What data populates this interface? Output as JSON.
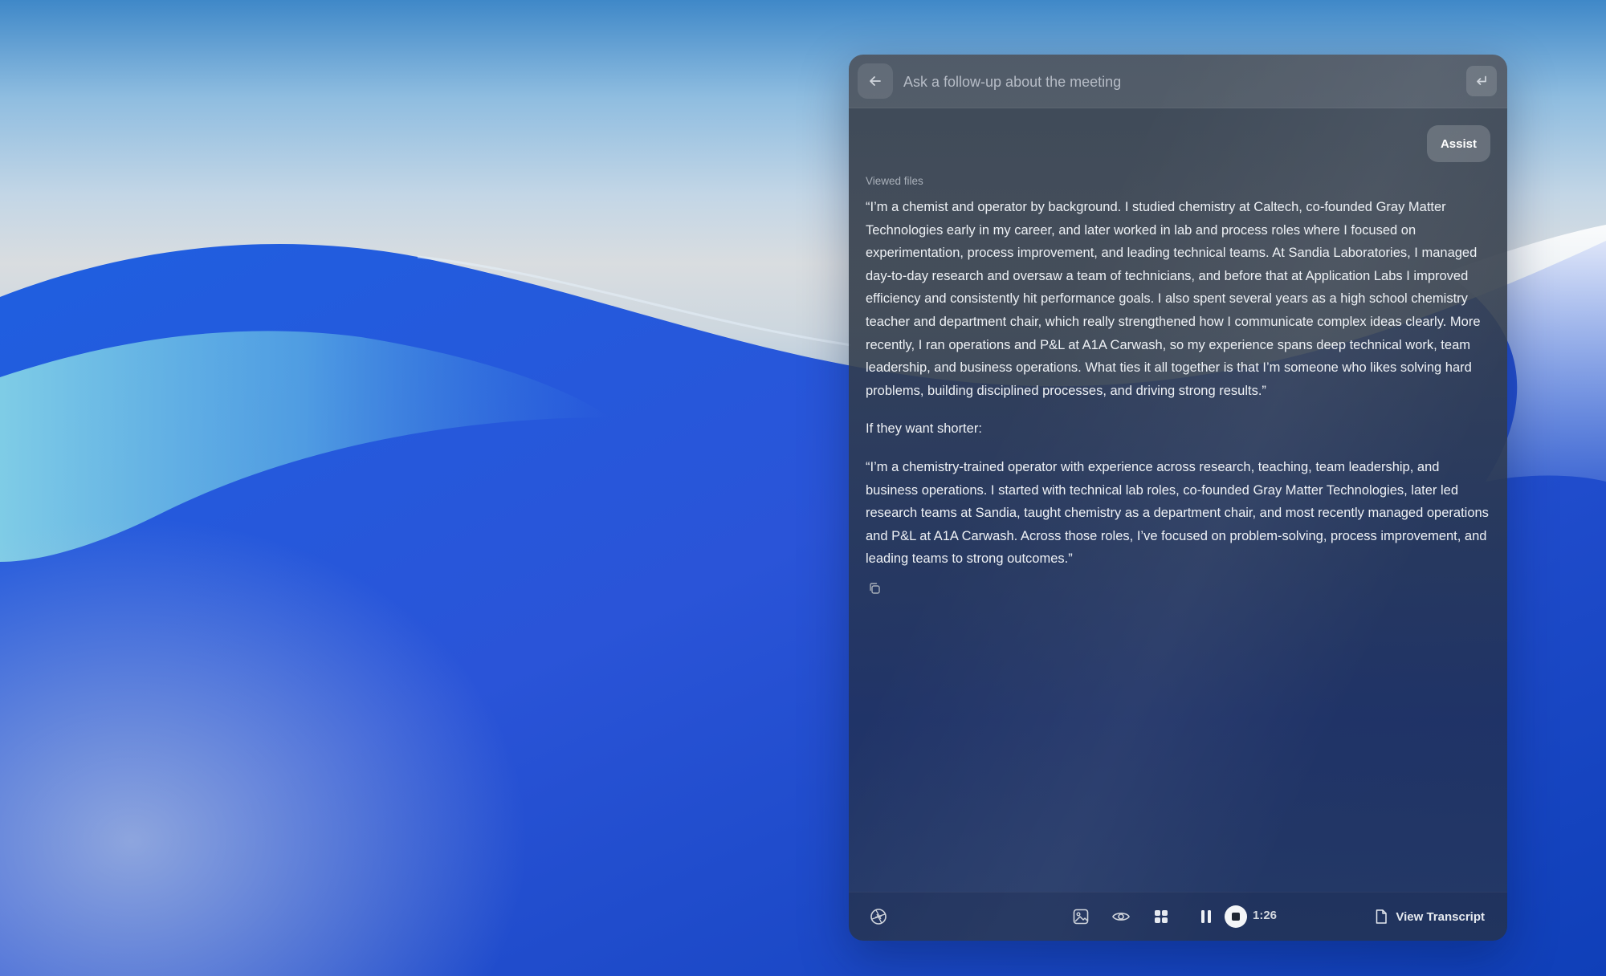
{
  "colors": {
    "panel_text": "#eef1f5",
    "muted_text": "#a9b0ba",
    "icon": "#d0d5dc"
  },
  "query_bar": {
    "placeholder": "Ask a follow-up about the meeting",
    "back_icon": "arrow-left-icon",
    "submit_icon": "enter-return-icon"
  },
  "assist_chip": {
    "label": "Assist"
  },
  "response": {
    "viewed_files_label": "Viewed files",
    "paragraphs": [
      "“I’m a chemist and operator by background. I studied chemistry at Caltech, co-founded Gray Matter Technologies early in my career, and later worked in lab and process roles where I focused on experimentation, process improvement, and leading technical teams. At Sandia Laboratories, I managed day-to-day research and oversaw a team of technicians, and before that at Application Labs I improved efficiency and consistently hit performance goals. I also spent several years as a high school chemistry teacher and department chair, which really strengthened how I communicate complex ideas clearly. More recently, I ran operations and P&L at A1A Carwash, so my experience spans deep technical work, team leadership, and business operations. What ties it all together is that I’m someone who likes solving hard problems, building disciplined processes, and driving strong results.”",
      "If they want shorter:",
      "“I’m a chemistry-trained operator with experience across research, teaching, team leadership, and business operations. I started with technical lab roles, co-founded Gray Matter Technologies, later led research teams at Sandia, taught chemistry as a department chair, and most recently managed operations and P&L at A1A Carwash. Across those roles, I’ve focused on problem-solving, process improvement, and leading teams to strong outcomes.”"
    ],
    "copy_icon": "copy-icon"
  },
  "toolbar": {
    "timer": "1:26",
    "view_transcript_label": "View Transcript",
    "icons": [
      "aperture-icon",
      "image-icon",
      "eye-icon",
      "grid-icon",
      "pause-icon",
      "stop-icon",
      "document-icon"
    ]
  }
}
